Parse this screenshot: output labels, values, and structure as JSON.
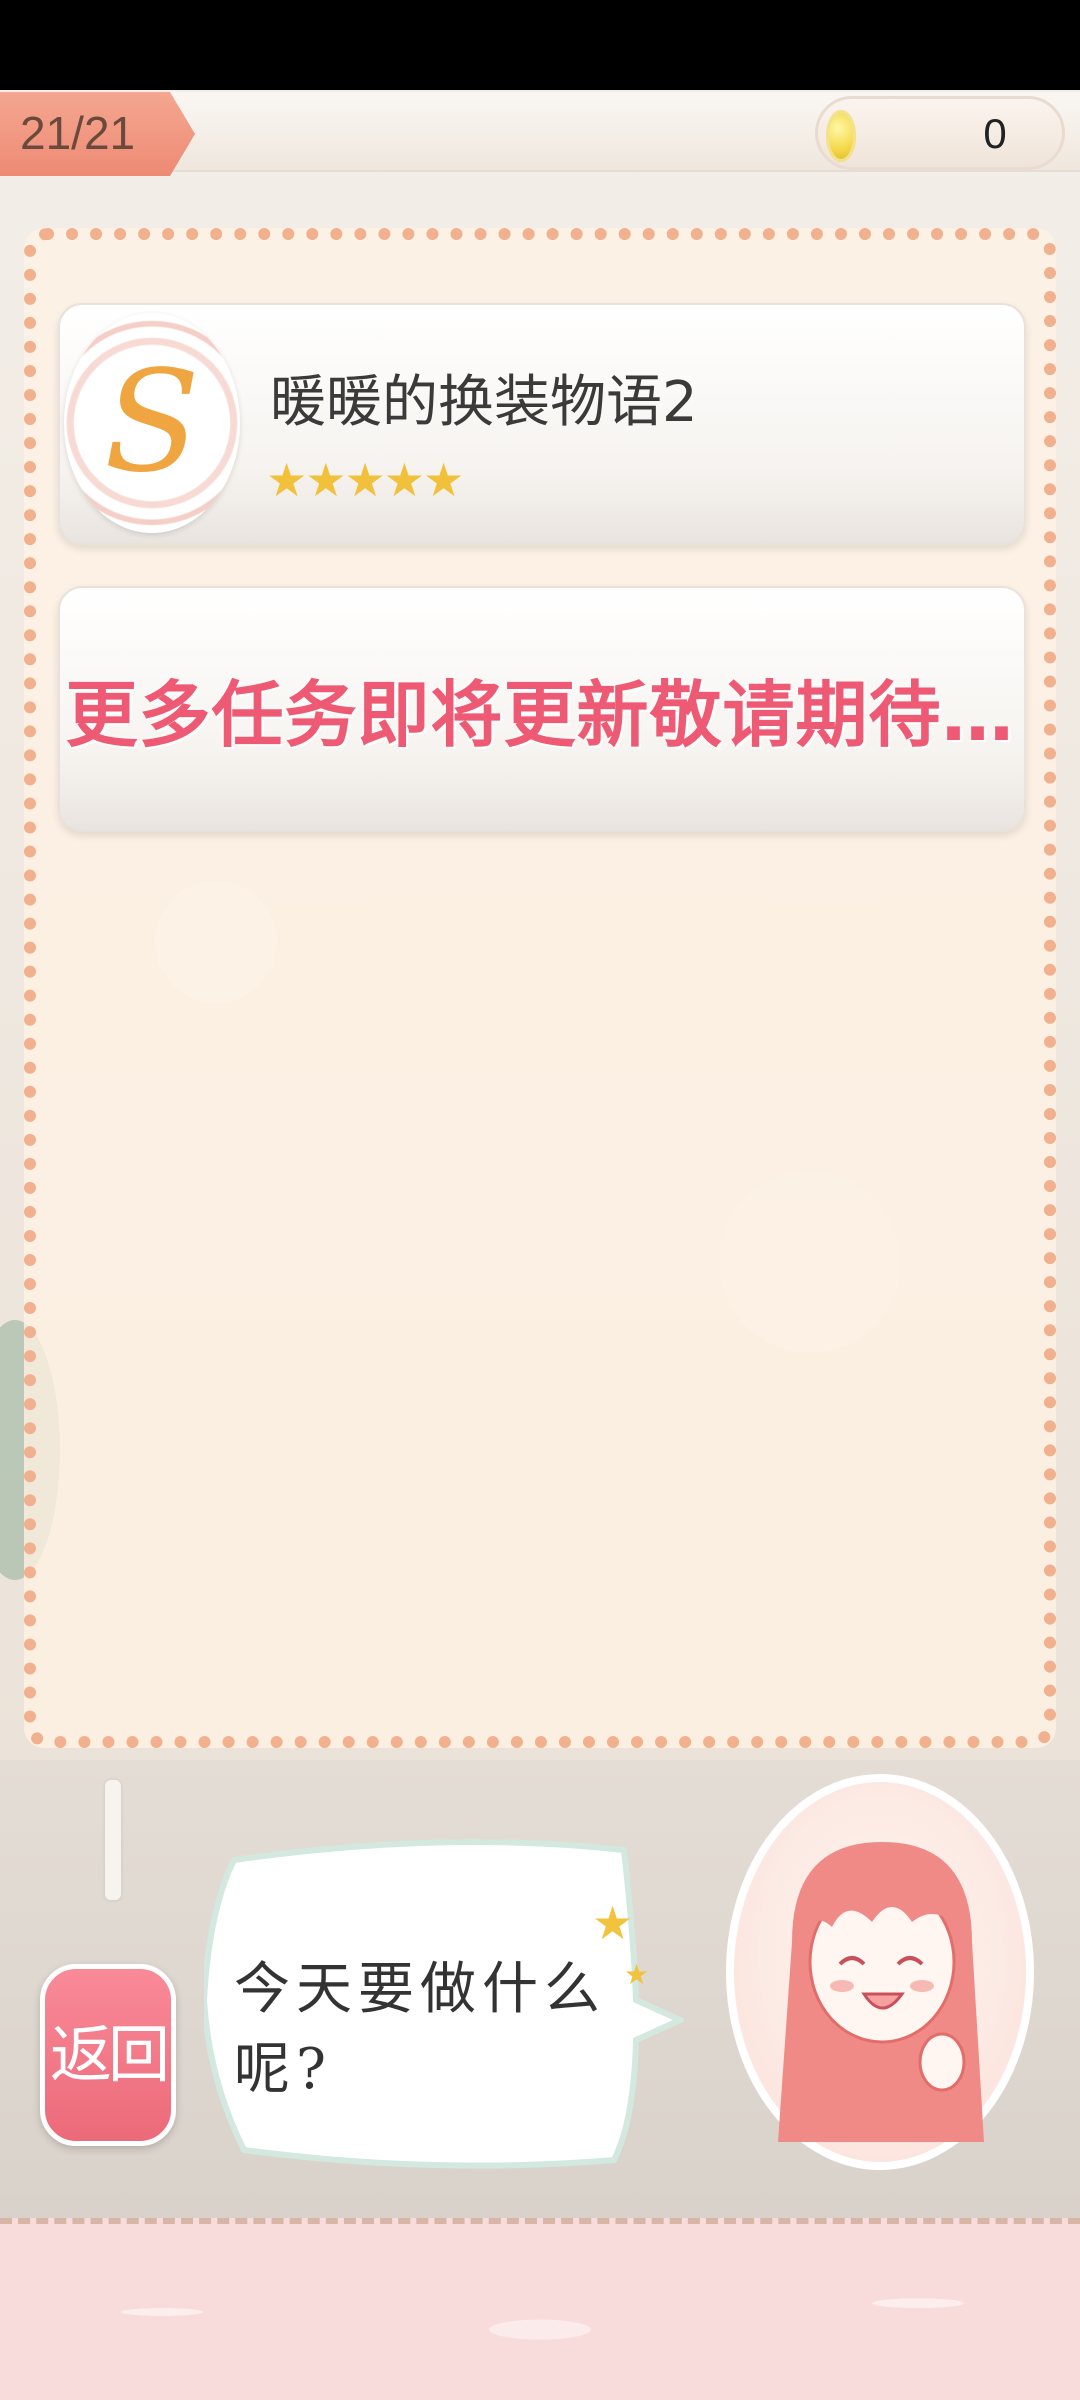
{
  "level": {
    "progress": "21/21"
  },
  "currency": {
    "icon": "coin-icon",
    "amount": "0"
  },
  "tasks": [
    {
      "badge_letter": "S",
      "title": "暖暖的换装物语2",
      "stars": "★★★★★",
      "rating": 5
    }
  ],
  "notice": {
    "text": "更多任务即将更新敬请期待…"
  },
  "back_button": {
    "label": "返回"
  },
  "speech": {
    "text": "今天要做什么呢?"
  },
  "colors": {
    "accent_pink": "#ee5a74",
    "star_gold": "#f2c13c",
    "tab_salmon": "#ee8a74"
  }
}
